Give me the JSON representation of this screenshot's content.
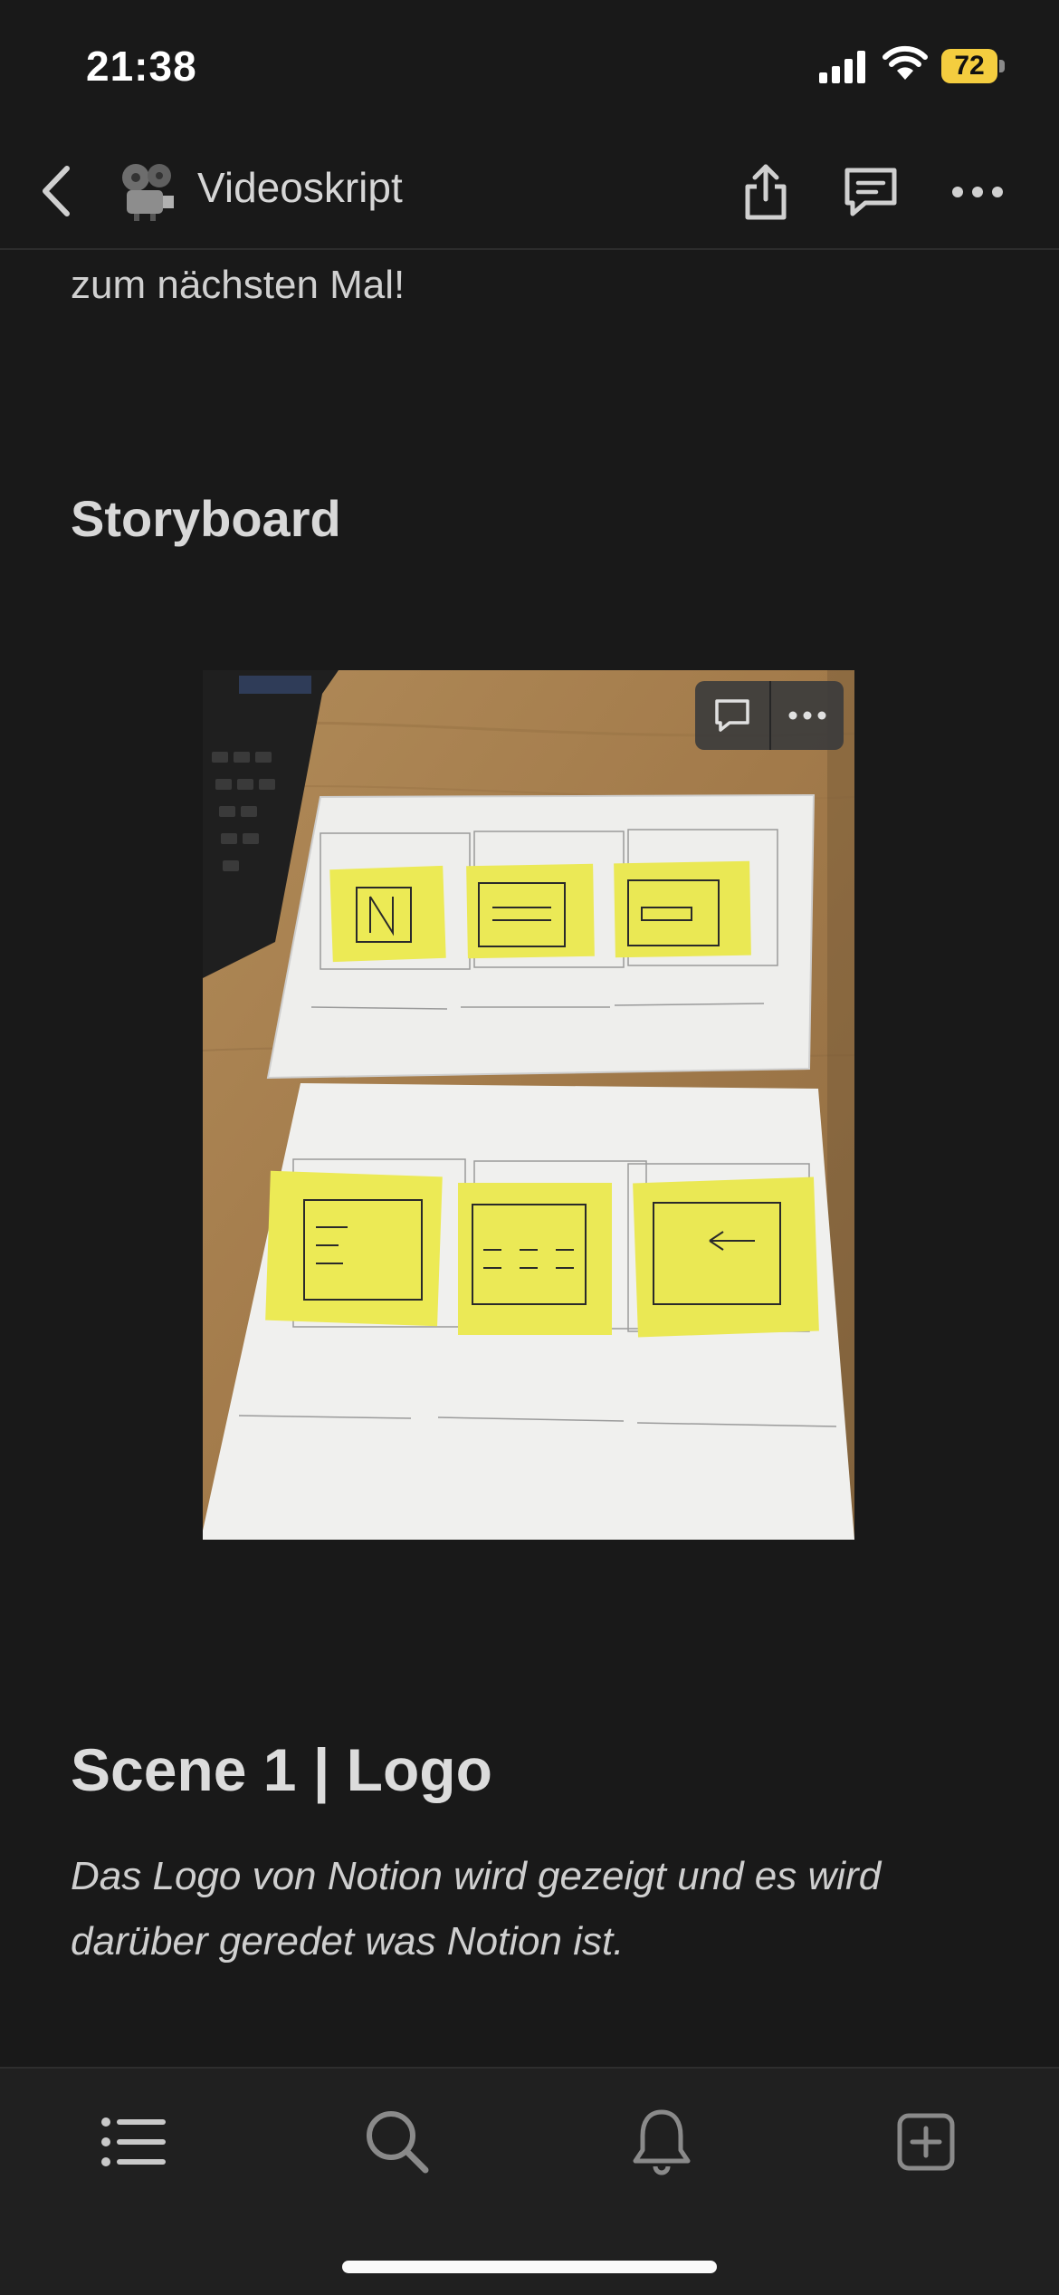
{
  "status": {
    "time": "21:38",
    "battery": "72"
  },
  "nav": {
    "title": "Videoskript",
    "page_icon": "film-projector-icon",
    "back_icon": "chevron-left-icon",
    "share_icon": "share-icon",
    "comments_icon": "comment-icon",
    "more_icon": "more-dots-icon"
  },
  "document": {
    "prev_text": "zum nächsten Mal!",
    "storyboard_heading": "Storyboard",
    "image": {
      "comment_icon": "comment-icon",
      "more_icon": "more-dots-icon"
    },
    "scene_heading": "Scene 1 | Logo",
    "scene_text": "Das Logo von Notion wird gezeigt und es wird darüber geredet was Notion ist."
  },
  "tabs": [
    {
      "icon": "list-icon"
    },
    {
      "icon": "search-icon"
    },
    {
      "icon": "bell-icon"
    },
    {
      "icon": "new-page-icon"
    }
  ]
}
